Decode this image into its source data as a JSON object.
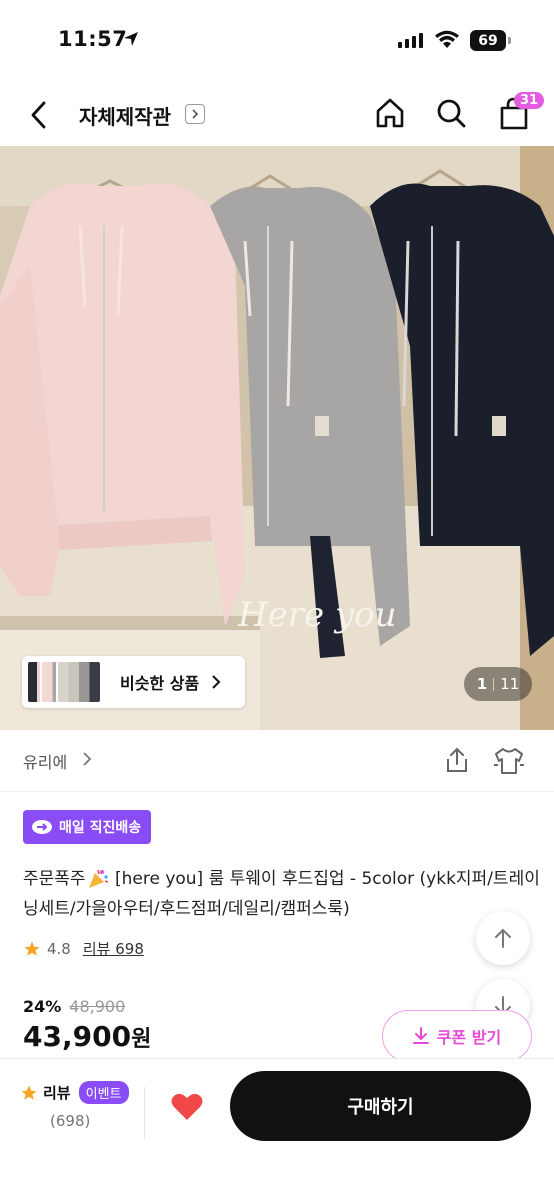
{
  "status": {
    "time": "11:57",
    "battery": "69"
  },
  "nav": {
    "store_name": "자체제작관",
    "cart_count": "31"
  },
  "gallery": {
    "current": "1",
    "total": "11",
    "similar_label": "비슷한 상품",
    "image_caption": "Here you"
  },
  "brand": {
    "name": "유리에"
  },
  "product": {
    "delivery_badge": "매일 직진배송",
    "title_prefix": "주문폭주",
    "title": "[here you] 룸 투웨이 후드집업 - 5color (ykk지퍼/트레이닝세트/가을아우터/후드점퍼/데일리/캠퍼스룩)",
    "rating": "4.8",
    "review_link": "리뷰 698",
    "discount": "24%",
    "original_price": "48,900",
    "price": "43,900",
    "price_unit": "원",
    "coupon_label": "쿠폰 받기"
  },
  "bottom": {
    "review_label": "리뷰",
    "event_label": "이벤트",
    "review_count": "(698)",
    "buy_label": "구매하기"
  },
  "colors": {
    "accent_pink": "#e64bd6",
    "accent_purple": "#8a4cf4",
    "star": "#f5a623",
    "heart": "#f04848"
  }
}
